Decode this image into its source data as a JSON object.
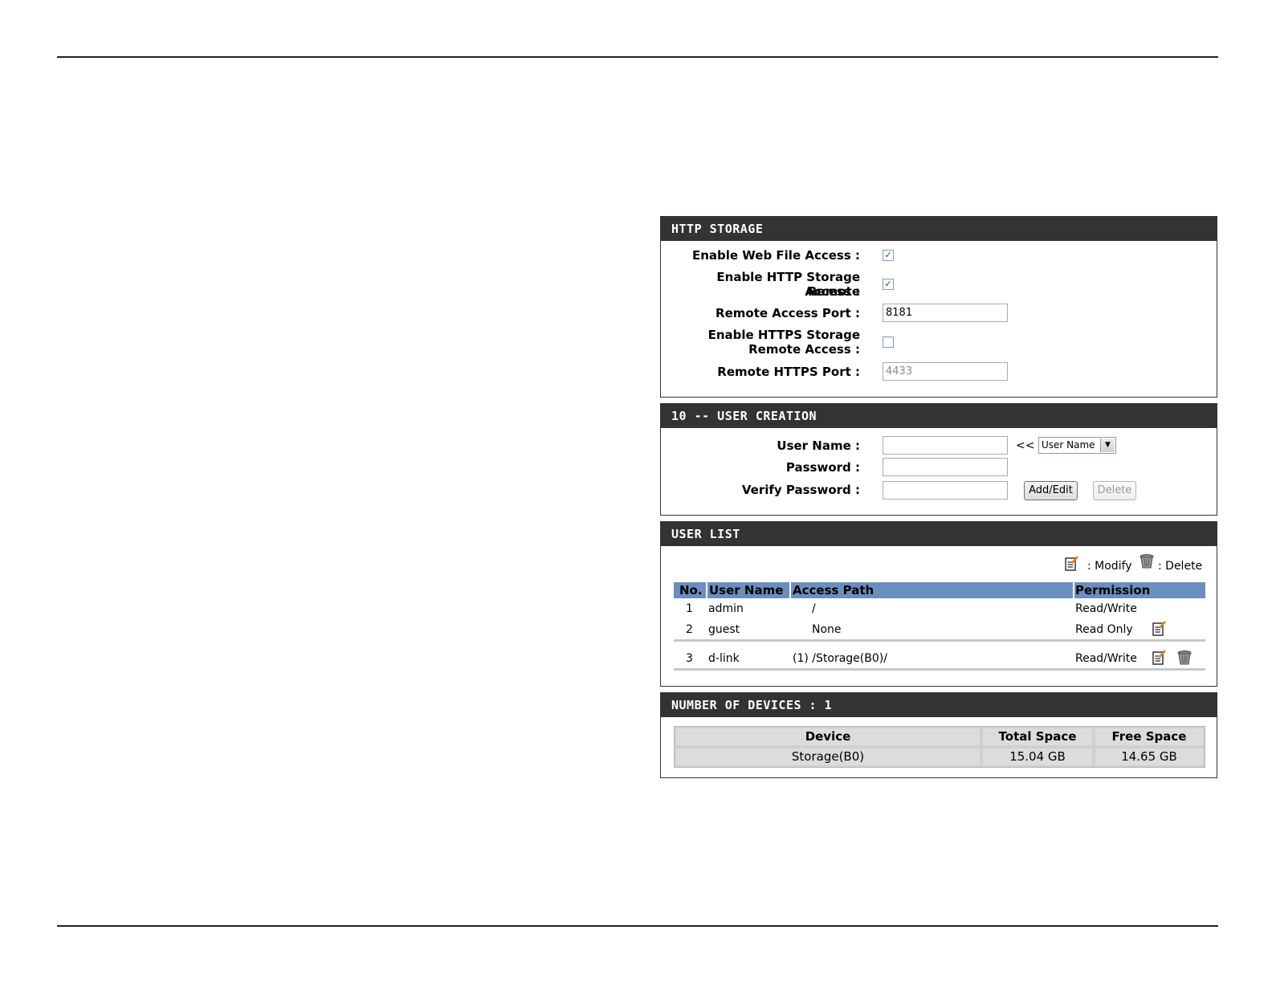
{
  "http_storage": {
    "title": "HTTP STORAGE",
    "enable_web_label": "Enable Web File Access :",
    "enable_web_checked": true,
    "enable_http_remote_label_1": "Enable HTTP Storage Remote",
    "enable_http_remote_label_2": "Access :",
    "enable_http_remote_checked": true,
    "remote_port_label": "Remote Access Port :",
    "remote_port_value": "8181",
    "enable_https_label_1": "Enable HTTPS Storage",
    "enable_https_label_2": "Remote Access :",
    "enable_https_checked": false,
    "https_port_label": "Remote HTTPS Port :",
    "https_port_value": "4433"
  },
  "user_creation": {
    "title": "10 -- USER CREATION",
    "username_label": "User Name :",
    "username_value": "",
    "arrow_text": "<<",
    "select_value": "User Name",
    "password_label": "Password :",
    "verify_label": "Verify Password :",
    "add_edit_label": "Add/Edit",
    "delete_label": "Delete"
  },
  "user_list": {
    "title": "USER LIST",
    "legend_modify": ": Modify",
    "legend_delete": ": Delete",
    "columns": [
      "No.",
      "User Name",
      "Access Path",
      "Permission"
    ],
    "rows": [
      {
        "no": "1",
        "user": "admin",
        "path": "/",
        "perm": "Read/Write"
      },
      {
        "no": "2",
        "user": "guest",
        "path": "None",
        "perm": "Read Only"
      },
      {
        "no": "3",
        "user": "d-link",
        "path": "(1) /Storage(B0)/",
        "perm": "Read/Write"
      }
    ],
    "icons": {
      "modify": "modify-icon",
      "delete": "trash-icon"
    }
  },
  "devices": {
    "title": "NUMBER OF DEVICES : 1",
    "columns": [
      "Device",
      "Total Space",
      "Free Space"
    ],
    "rows": [
      {
        "device": "Storage(B0)",
        "total": "15.04 GB",
        "free": "14.65 GB"
      }
    ]
  },
  "colors": {
    "header_bg": "#333333",
    "table_header_bg": "#6c8ebf"
  }
}
